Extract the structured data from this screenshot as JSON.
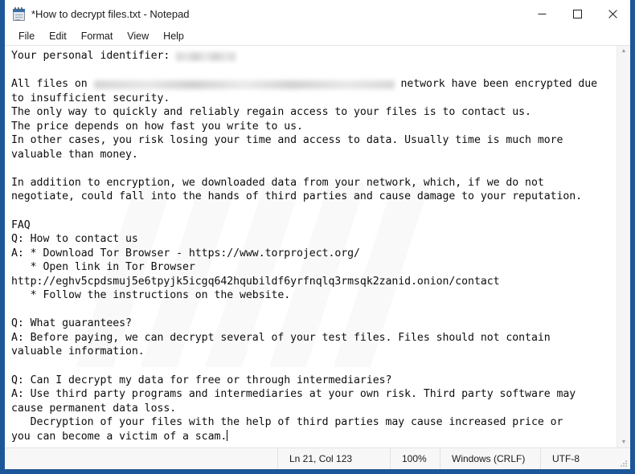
{
  "window": {
    "title": "*How to decrypt files.txt - Notepad",
    "icon": "notepad-icon",
    "border_color": "#1e5799",
    "controls": {
      "minimize": "minimize-icon",
      "maximize": "maximize-icon",
      "close": "close-icon"
    }
  },
  "menubar": {
    "items": [
      {
        "label": "File"
      },
      {
        "label": "Edit"
      },
      {
        "label": "Format"
      },
      {
        "label": "View"
      },
      {
        "label": "Help"
      }
    ]
  },
  "document": {
    "lines": [
      {
        "type": "text",
        "prefix": "Your personal identifier: ",
        "redacted": "small"
      },
      {
        "type": "blank"
      },
      {
        "type": "text",
        "prefix": "All files on ",
        "redacted": "big",
        "suffix": " network have been encrypted due"
      },
      {
        "type": "text",
        "text": "to insufficient security."
      },
      {
        "type": "text",
        "text": "The only way to quickly and reliably regain access to your files is to contact us."
      },
      {
        "type": "text",
        "text": "The price depends on how fast you write to us."
      },
      {
        "type": "text",
        "text": "In other cases, you risk losing your time and access to data. Usually time is much more"
      },
      {
        "type": "text",
        "text": "valuable than money."
      },
      {
        "type": "blank"
      },
      {
        "type": "text",
        "text": "In addition to encryption, we downloaded data from your network, which, if we do not"
      },
      {
        "type": "text",
        "text": "negotiate, could fall into the hands of third parties and cause damage to your reputation."
      },
      {
        "type": "blank"
      },
      {
        "type": "text",
        "text": "FAQ"
      },
      {
        "type": "text",
        "text": "Q: How to contact us"
      },
      {
        "type": "text",
        "text": "A: * Download Tor Browser - https://www.torproject.org/"
      },
      {
        "type": "text",
        "text": "   * Open link in Tor Browser"
      },
      {
        "type": "text",
        "text": "http://eghv5cpdsmuj5e6tpyjk5icgq642hqubildf6yrfnqlq3rmsqk2zanid.onion/contact"
      },
      {
        "type": "text",
        "text": "   * Follow the instructions on the website."
      },
      {
        "type": "blank"
      },
      {
        "type": "text",
        "text": "Q: What guarantees?"
      },
      {
        "type": "text",
        "text": "A: Before paying, we can decrypt several of your test files. Files should not contain"
      },
      {
        "type": "text",
        "text": "valuable information."
      },
      {
        "type": "blank"
      },
      {
        "type": "text",
        "text": "Q: Can I decrypt my data for free or through intermediaries?"
      },
      {
        "type": "text",
        "text": "A: Use third party programs and intermediaries at your own risk. Third party software may"
      },
      {
        "type": "text",
        "text": "cause permanent data loss."
      },
      {
        "type": "text",
        "text": "   Decryption of your files with the help of third parties may cause increased price or"
      },
      {
        "type": "text",
        "text": "you can become a victim of a scam.",
        "caret": true
      }
    ]
  },
  "scrollbar": {
    "up_arrow": "scroll-up-icon",
    "down_arrow": "scroll-down-icon"
  },
  "statusbar": {
    "position": "Ln 21, Col 123",
    "zoom": "100%",
    "line_ending": "Windows (CRLF)",
    "encoding": "UTF-8"
  }
}
